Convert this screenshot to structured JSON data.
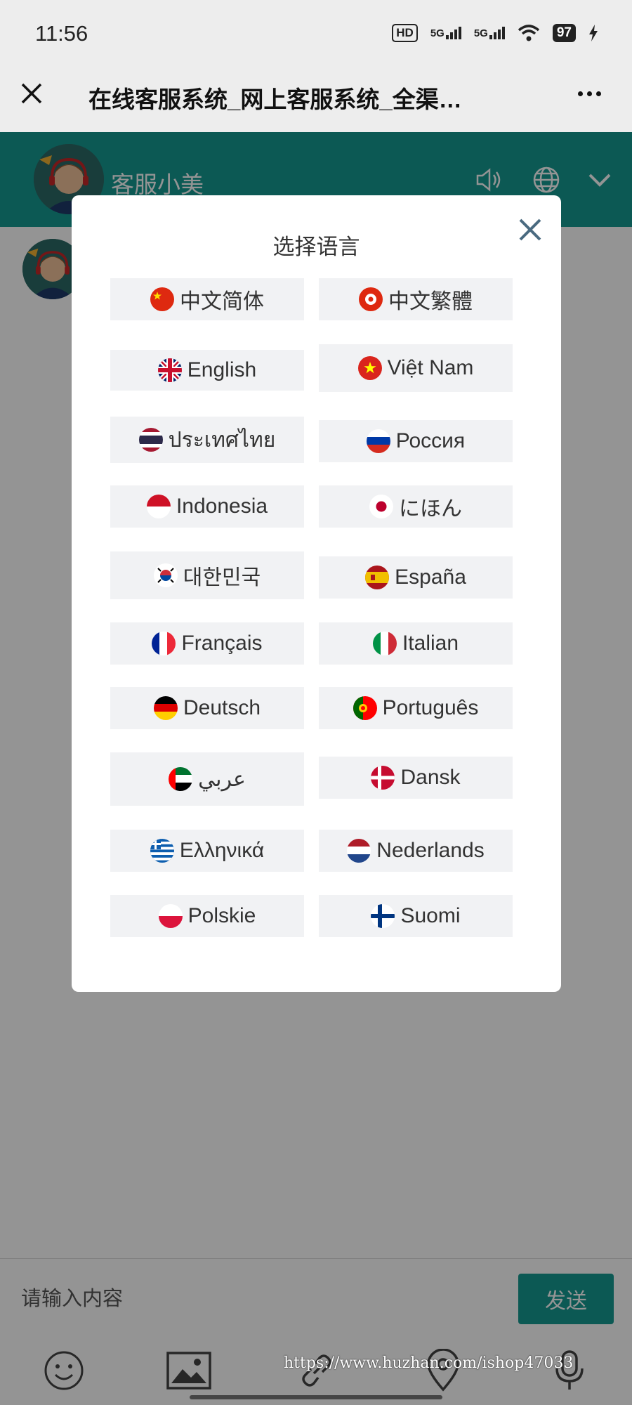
{
  "status_bar": {
    "time": "11:56",
    "hd_badge": "HD",
    "net1": "5G",
    "net2": "5G",
    "battery": "97",
    "icons": [
      "hd-icon",
      "signal-icon",
      "signal-icon",
      "wifi-icon",
      "battery-icon",
      "charging-icon"
    ]
  },
  "browser": {
    "title": "在线客服系统_网上客服系统_全渠…",
    "close_icon": "close-icon",
    "menu_icon": "more-icon"
  },
  "chat_header": {
    "agent_name": "客服小美",
    "icons": [
      "agent-avatar",
      "speaker-icon",
      "globe-icon",
      "chevron-down-icon"
    ],
    "bg_color": "#159a92"
  },
  "language_modal": {
    "title": "选择语言",
    "close_icon": "close-icon",
    "languages": [
      {
        "label": "中文简体",
        "flag": "china-flag-icon"
      },
      {
        "label": "中文繁體",
        "flag": "hongkong-flag-icon"
      },
      {
        "label": "English",
        "flag": "uk-flag-icon"
      },
      {
        "label": "Việt Nam",
        "flag": "vietnam-flag-icon"
      },
      {
        "label": "ประเทศไทย",
        "flag": "thailand-flag-icon"
      },
      {
        "label": "Россия",
        "flag": "russia-flag-icon"
      },
      {
        "label": "Indonesia",
        "flag": "indonesia-flag-icon"
      },
      {
        "label": "にほん",
        "flag": "japan-flag-icon"
      },
      {
        "label": "대한민국",
        "flag": "korea-flag-icon"
      },
      {
        "label": "España",
        "flag": "spain-flag-icon"
      },
      {
        "label": "Français",
        "flag": "france-flag-icon"
      },
      {
        "label": "Italian",
        "flag": "italy-flag-icon"
      },
      {
        "label": "Deutsch",
        "flag": "germany-flag-icon"
      },
      {
        "label": "Português",
        "flag": "portugal-flag-icon"
      },
      {
        "label": "عربي",
        "flag": "uae-flag-icon"
      },
      {
        "label": "Dansk",
        "flag": "denmark-flag-icon"
      },
      {
        "label": "Ελληνικά",
        "flag": "greece-flag-icon"
      },
      {
        "label": "Nederlands",
        "flag": "netherlands-flag-icon"
      },
      {
        "label": "Polskie",
        "flag": "poland-flag-icon"
      },
      {
        "label": "Suomi",
        "flag": "finland-flag-icon"
      }
    ]
  },
  "input_bar": {
    "placeholder": "请输入内容",
    "send_label": "发送"
  },
  "toolbar": {
    "icons": [
      "emoji-icon",
      "image-icon",
      "link-icon",
      "location-icon",
      "microphone-icon"
    ]
  },
  "watermark": "https://www.huzhan.com/ishop47033"
}
